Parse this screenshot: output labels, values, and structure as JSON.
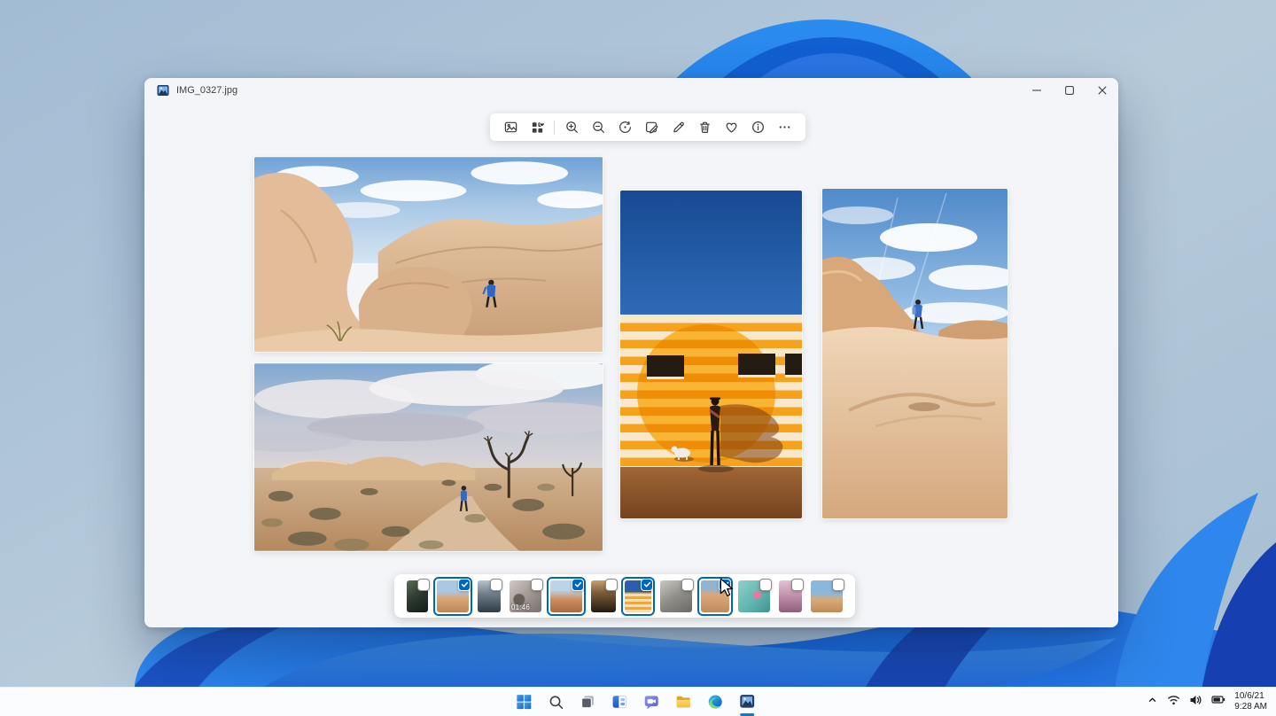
{
  "accent_color": "#0067c0",
  "window": {
    "title": "IMG_0327.jpg",
    "controls": {
      "minimize": "minimize",
      "maximize": "maximize",
      "close": "close"
    }
  },
  "toolbar": {
    "icons": [
      "image-view",
      "grid-favorites",
      "zoom-in",
      "zoom-out",
      "rotate",
      "crop-edit",
      "markup-pencil",
      "delete",
      "favorite",
      "info",
      "more"
    ]
  },
  "photos": [
    {
      "label": "desert-rock-canyon-with-hiker-landscape"
    },
    {
      "label": "joshua-tree-desert-with-person-landscape"
    },
    {
      "label": "orange-striped-wall-with-person-portrait"
    },
    {
      "label": "desert-sky-with-hiker-portrait"
    }
  ],
  "filmstrip": {
    "items": [
      {
        "style": "forest",
        "checked": false
      },
      {
        "style": "desert-rocks",
        "checked": true
      },
      {
        "style": "cliff",
        "checked": false
      },
      {
        "style": "video-group",
        "checked": false,
        "duration": "01:46"
      },
      {
        "style": "desert-red",
        "checked": true
      },
      {
        "style": "sunset",
        "checked": false
      },
      {
        "style": "orange-wall",
        "checked": true
      },
      {
        "style": "gray-rocks",
        "checked": false
      },
      {
        "style": "desert-dune",
        "checked": true
      },
      {
        "style": "pool",
        "checked": false
      },
      {
        "style": "pink-sky",
        "checked": false
      },
      {
        "style": "beach",
        "checked": false
      }
    ]
  },
  "taskbar": {
    "icons": [
      "start",
      "search",
      "task-view",
      "widgets",
      "chat",
      "file-explorer",
      "edge",
      "photos"
    ],
    "tray": {
      "date": "10/6/21",
      "time": "9:28 AM"
    }
  }
}
